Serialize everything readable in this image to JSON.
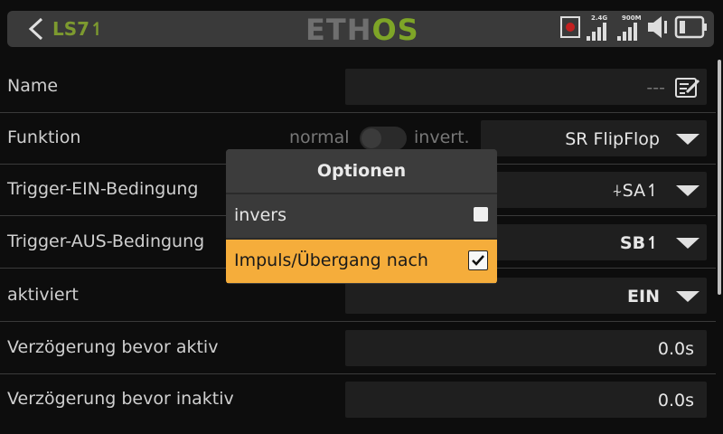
{
  "header": {
    "title": "LS7",
    "title_suffix": "↿",
    "logo_left": "ETH",
    "logo_right": "OS",
    "signal_24": "2.4G",
    "signal_900": "900M"
  },
  "rows": [
    {
      "label": "Name",
      "value": "---"
    },
    {
      "label": "Funktion",
      "toggle_left": "normal",
      "toggle_right": "invert.",
      "value": "SR FlipFlop"
    },
    {
      "label": "Trigger-EIN-Bedingung",
      "value": "⍭SA↿"
    },
    {
      "label": "Trigger-AUS-Bedingung",
      "value": "SB↿"
    },
    {
      "label": "aktiviert",
      "value": "EIN"
    },
    {
      "label": "Verzögerung bevor aktiv",
      "value": "0.0s"
    },
    {
      "label": "Verzögerung bevor inaktiv",
      "value": "0.0s"
    }
  ],
  "dialog": {
    "title": "Optionen",
    "options": [
      {
        "label": "invers",
        "checked": false
      },
      {
        "label": "Impuls/Übergang nach",
        "checked": true
      }
    ]
  },
  "colors": {
    "accent": "#f5ad3b",
    "logo_green": "#7ea527",
    "title_green": "#7d9a2f"
  }
}
